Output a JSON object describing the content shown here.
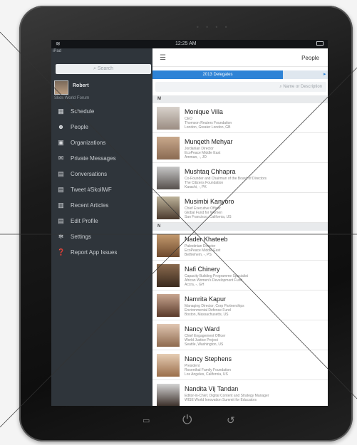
{
  "status": {
    "time": "12:25 AM"
  },
  "sidebar": {
    "device_label": "iPad",
    "search_placeholder": "Search",
    "user_name": "Robert",
    "forum": "Skoll World Forum",
    "items": [
      {
        "label": "Schedule",
        "icon": "calendar-icon"
      },
      {
        "label": "People",
        "icon": "people-icon"
      },
      {
        "label": "Organizations",
        "icon": "building-icon"
      },
      {
        "label": "Private Messages",
        "icon": "mail-icon"
      },
      {
        "label": "Conversations",
        "icon": "list-icon"
      },
      {
        "label": "Tweet #SkollWF",
        "icon": "list-icon"
      },
      {
        "label": "Recent Articles",
        "icon": "newspaper-icon"
      },
      {
        "label": "Edit Profile",
        "icon": "list-icon"
      },
      {
        "label": "Settings",
        "icon": "gear-icon"
      },
      {
        "label": "Report App Issues",
        "icon": "help-icon"
      }
    ]
  },
  "main": {
    "title": "People",
    "tab_label": "2013 Delegates",
    "search_placeholder": "Name or Description",
    "sections": [
      {
        "letter": "M",
        "people": [
          {
            "name": "Monique Villa",
            "role": "CEO",
            "org": "Thomson Reuters Foundation",
            "location": "London, Greater London, GB"
          },
          {
            "name": "Munqeth Mehyar",
            "role": "Jordanian Director",
            "org": "EcoPeace Middle East",
            "location": "Amman, -, JO"
          },
          {
            "name": "Mushtaq Chhapra",
            "role": "Co-Founder and Chairman of the Board of Directors",
            "org": "The Citizens Foundation",
            "location": "Karachi, -, PK"
          },
          {
            "name": "Musimbi Kanyoro",
            "role": "Chief Executive Officer",
            "org": "Global Fund for Women",
            "location": "San Francisco, California, US"
          }
        ]
      },
      {
        "letter": "N",
        "people": [
          {
            "name": "Nader Khateeb",
            "role": "Palestinian Director",
            "org": "EcoPeace Middle East",
            "location": "Bethlehem, -, PS"
          },
          {
            "name": "Nafi Chinery",
            "role": "Capacity Building Programme Specialist",
            "org": "African Women's Development Fund",
            "location": "Accra, -, GH"
          },
          {
            "name": "Namrita Kapur",
            "role": "Managing Director, Corp Partnerships",
            "org": "Environmental Defense Fund",
            "location": "Boston, Massachusetts, US"
          },
          {
            "name": "Nancy Ward",
            "role": "Chief Engagement Officer",
            "org": "World Justice Project",
            "location": "Seattle, Washington, US"
          },
          {
            "name": "Nancy Stephens",
            "role": "President",
            "org": "Rosenthal Family Foundation",
            "location": "Los Angeles, California, US"
          },
          {
            "name": "Nandita Vij Tandan",
            "role": "Editor-in-Chief, Digital Content and Strategy Manager",
            "org": "WISE World Innovation Summit for Educators",
            "location": ""
          }
        ]
      }
    ]
  },
  "colors": {
    "accent": "#2e83d6",
    "sidebar_bg": "#2f353b"
  }
}
